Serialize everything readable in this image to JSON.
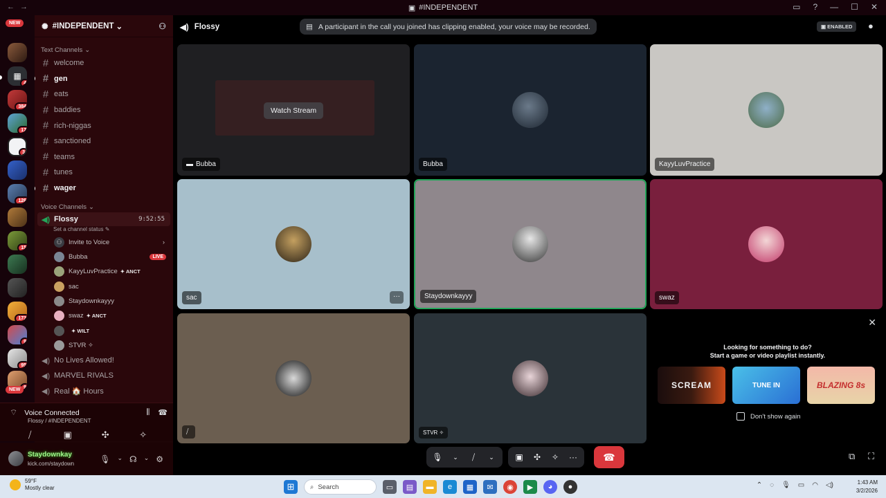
{
  "window": {
    "title": "#INDEPENDENT"
  },
  "rail": {
    "new_label": "NEW",
    "badges": [
      "4",
      "384",
      "17",
      "3",
      "126",
      "15",
      "173",
      "9",
      "95",
      "9"
    ]
  },
  "sidebar": {
    "server_name": "#INDEPENDENT",
    "text_category": "Text Channels",
    "text_channels": [
      {
        "name": "welcome",
        "unread": false
      },
      {
        "name": "gen",
        "unread": true
      },
      {
        "name": "eats",
        "unread": false
      },
      {
        "name": "baddies",
        "unread": false
      },
      {
        "name": "rich-niggas",
        "unread": false
      },
      {
        "name": "sanctioned",
        "unread": false
      },
      {
        "name": "teams",
        "unread": false
      },
      {
        "name": "tunes",
        "unread": false
      },
      {
        "name": "wager",
        "unread": true
      }
    ],
    "voice_category": "Voice Channels",
    "active_voice": {
      "name": "Flossy",
      "timer": "9:52:55",
      "status_placeholder": "Set a channel status"
    },
    "invite_label": "Invite to Voice",
    "voice_users": [
      {
        "name": "Bubba",
        "badge": "LIVE",
        "tag": ""
      },
      {
        "name": "KayyLuvPractice",
        "badge": "",
        "tag": "ANCT"
      },
      {
        "name": "sac",
        "badge": "",
        "tag": ""
      },
      {
        "name": "Staydownkayyy",
        "badge": "",
        "tag": ""
      },
      {
        "name": "swaz",
        "badge": "",
        "tag": "ANCT"
      },
      {
        "name": "",
        "badge": "",
        "tag": "WILT"
      },
      {
        "name": "STVR ✧",
        "badge": "",
        "tag": ""
      }
    ],
    "other_voice": [
      "No Lives Allowed!",
      "MARVEL RIVALS",
      "Real 🏠 Hours"
    ]
  },
  "voice_panel": {
    "title": "Voice Connected",
    "subtitle": "Flossy / #INDEPENDENT"
  },
  "user": {
    "name": "Staydownkay",
    "subtitle": "kick.com/staydown"
  },
  "call": {
    "channel": "Flossy",
    "notice": "A participant in the call you joined has clipping enabled, your voice may be recorded.",
    "enabled_label": "ENABLED",
    "watch_label": "Watch Stream",
    "tiles": [
      {
        "name": "Bubba",
        "bg": "#1f1f22"
      },
      {
        "name": "Bubba",
        "bg": "#1b2430"
      },
      {
        "name": "KayyLuvPractice",
        "bg": "#c9c7c3"
      },
      {
        "name": "sac",
        "bg": "#a7bfcb"
      },
      {
        "name": "Staydownkayyy",
        "bg": "#8f878c"
      },
      {
        "name": "swaz",
        "bg": "#791f3d"
      },
      {
        "name": "",
        "bg": "#6b5e50"
      },
      {
        "name": "STVR ✧",
        "bg": "#2a3339"
      }
    ]
  },
  "activity": {
    "line1": "Looking for something to do?",
    "line2": "Start a game or video playlist instantly.",
    "games": [
      "SCREAM",
      "TUNE IN",
      "BLAZING 8s"
    ],
    "dont_show": "Don't show again"
  },
  "taskbar": {
    "temp": "59°F",
    "weather": "Mostly clear",
    "search_label": "Search",
    "time": "1:43 AM",
    "date": "3/2/2026"
  }
}
